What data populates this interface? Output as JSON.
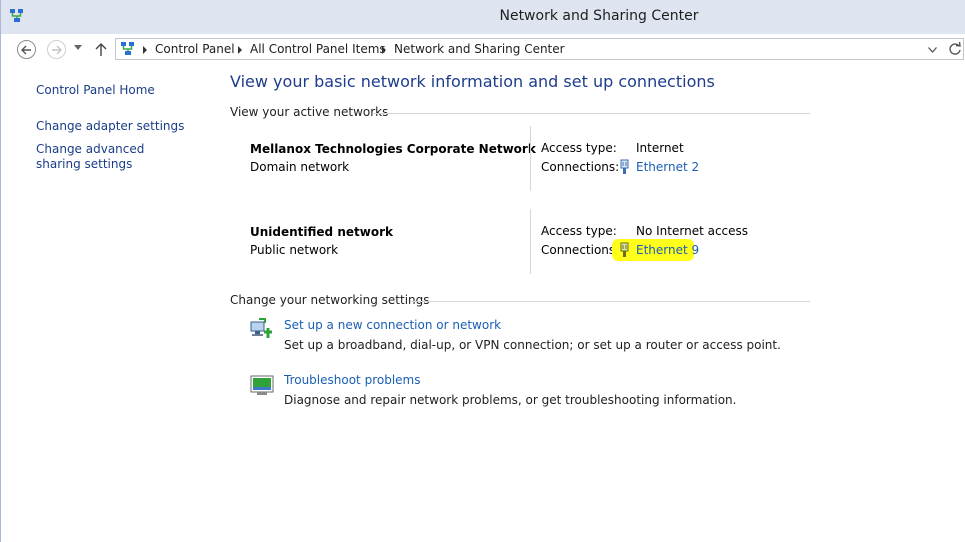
{
  "window": {
    "title": "Network and Sharing Center"
  },
  "address": {
    "crumbs": [
      "Control Panel",
      "All Control Panel Items",
      "Network and Sharing Center"
    ]
  },
  "sidebar": {
    "items": [
      {
        "label": "Control Panel Home"
      },
      {
        "label": "Change adapter settings"
      },
      {
        "label": "Change advanced sharing settings"
      }
    ]
  },
  "main": {
    "title": "View your basic network information and set up connections",
    "active_networks_heading": "View your active networks",
    "networks": [
      {
        "name": "Mellanox Technologies Corporate Network",
        "type": "Domain network",
        "access_label": "Access type:",
        "access_value": "Internet",
        "connections_label": "Connections:",
        "connection": "Ethernet 2",
        "highlighted": false
      },
      {
        "name": "Unidentified network",
        "type": "Public network",
        "access_label": "Access type:",
        "access_value": "No Internet access",
        "connections_label": "Connections:",
        "connection": "Ethernet 9",
        "highlighted": true
      }
    ],
    "settings_heading": "Change your networking settings",
    "tasks": [
      {
        "link": "Set up a new connection or network",
        "desc": "Set up a broadband, dial-up, or VPN connection; or set up a router or access point.",
        "icon": "new-connection-icon"
      },
      {
        "link": "Troubleshoot problems",
        "desc": "Diagnose and repair network problems, or get troubleshooting information.",
        "icon": "troubleshoot-icon"
      }
    ]
  },
  "colors": {
    "link": "#1a5fb4",
    "title": "#1e3c8c",
    "highlight": "#ffff1a"
  }
}
